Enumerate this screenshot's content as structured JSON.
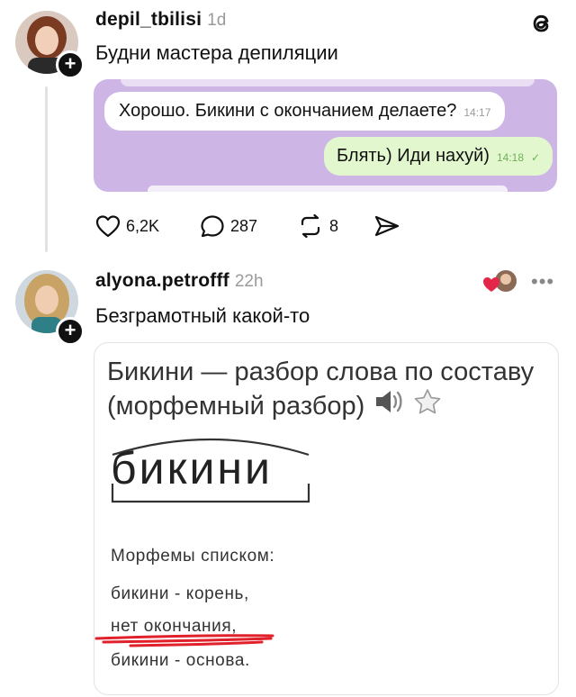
{
  "post1": {
    "username": "depil_tbilisi",
    "time": "1d",
    "text": "Будни мастера депиляции",
    "chat": {
      "incoming_text": "Хорошо. Бикини с окончанием делаете?",
      "incoming_time": "14:17",
      "outgoing_text": "Блять) Иди нахуй)",
      "outgoing_time": "14:18"
    },
    "actions": {
      "likes": "6,2K",
      "comments": "287",
      "reposts": "8"
    }
  },
  "post2": {
    "username": "alyona.petrofff",
    "time": "22h",
    "text": "Безграмотный какой-то",
    "card": {
      "title_line1": "Бикини — разбор слова по составу",
      "title_line2": "(морфемный разбор)",
      "word": "бикини",
      "morphemes_header": "Морфемы списком:",
      "morpheme1": "бикини - корень,",
      "morpheme2": "нет окончания,",
      "morpheme3": "бикини - основа."
    }
  },
  "colors": {
    "chat_background": "#cdb6e6",
    "incoming_bubble": "#ffffff",
    "outgoing_bubble": "#e3f7cf",
    "underline_annotation": "#e0202a"
  }
}
